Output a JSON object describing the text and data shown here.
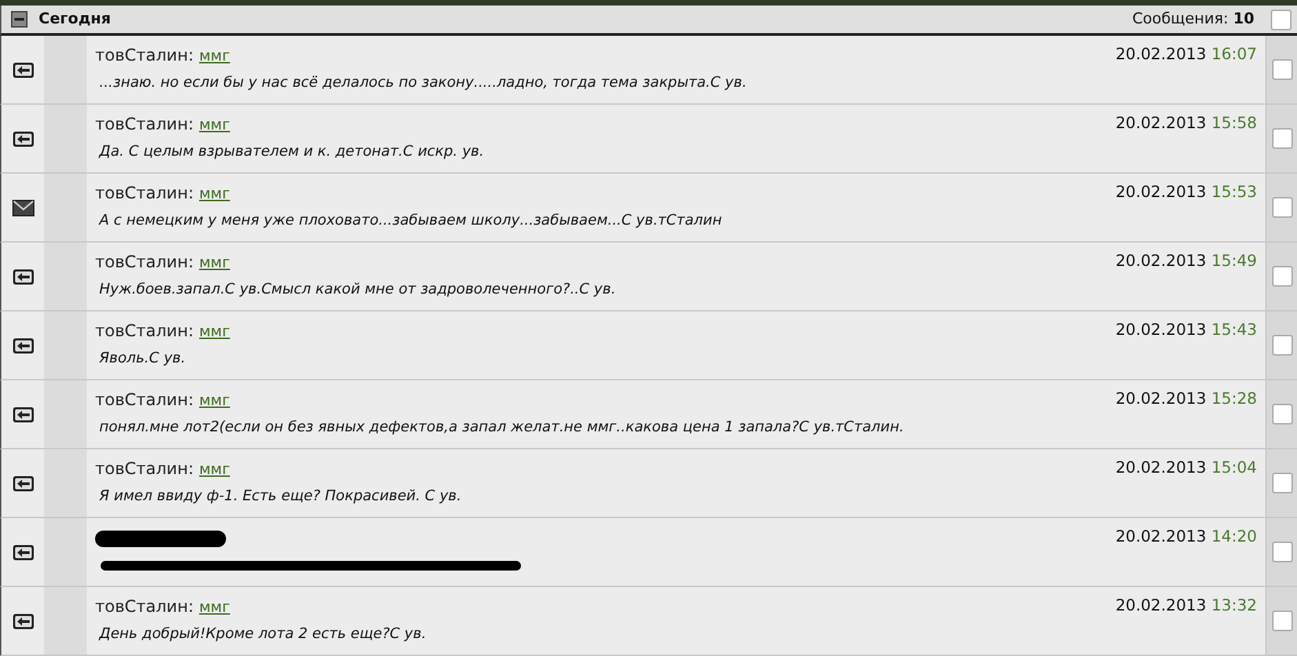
{
  "group": {
    "title": "Сегодня",
    "expanded": true,
    "count_label": "Сообщения: **10**",
    "checked": false
  },
  "messages": [
    {
      "kind": "reply",
      "author": "товСталин:",
      "recipient": "ммг",
      "text": "...знаю. но если бы у нас всё делалось по закону.....ладно, тогда тема закрыта.С ув.",
      "date": "20.02.2013",
      "time": "16:07",
      "checked": false
    },
    {
      "kind": "reply",
      "author": "товСталин:",
      "recipient": "ммг",
      "text": "Да. С целым взрывателем и к. детонат.С искр. ув.",
      "date": "20.02.2013",
      "time": "15:58",
      "checked": false
    },
    {
      "kind": "mail",
      "author": "товСталин:",
      "recipient": "ммг",
      "text": "А с немецким у меня уже плоховато...забываем школу...забываем...С ув.тСталин",
      "date": "20.02.2013",
      "time": "15:53",
      "checked": false
    },
    {
      "kind": "reply",
      "author": "товСталин:",
      "recipient": "ммг",
      "text": "Нуж.боев.запал.С ув.Смысл какой мне от задроволеченного?..С ув.",
      "date": "20.02.2013",
      "time": "15:49",
      "checked": false
    },
    {
      "kind": "reply",
      "author": "товСталин:",
      "recipient": "ммг",
      "text": "Яволь.С ув.",
      "date": "20.02.2013",
      "time": "15:43",
      "checked": false
    },
    {
      "kind": "reply",
      "author": "товСталин:",
      "recipient": "ммг",
      "text": "понял.мне лот2(если он без явных дефектов,а запал желат.не ммг..какова цена 1 запала?С ув.тСталин.",
      "date": "20.02.2013",
      "time": "15:28",
      "checked": false
    },
    {
      "kind": "reply",
      "author": "товСталин:",
      "recipient": "ммг",
      "text": "Я имел ввиду ф-1. Есть еще? Покрасивей. С ув.",
      "date": "20.02.2013",
      "time": "15:04",
      "checked": false
    },
    {
      "kind": "reply",
      "redacted": true,
      "date": "20.02.2013",
      "time": "14:20",
      "checked": false
    },
    {
      "kind": "reply",
      "author": "товСталин:",
      "recipient": "ммг",
      "text": "День добрый!Кроме лота 2 есть еще?С ув.",
      "date": "20.02.2013",
      "time": "13:32",
      "checked": false
    }
  ]
}
